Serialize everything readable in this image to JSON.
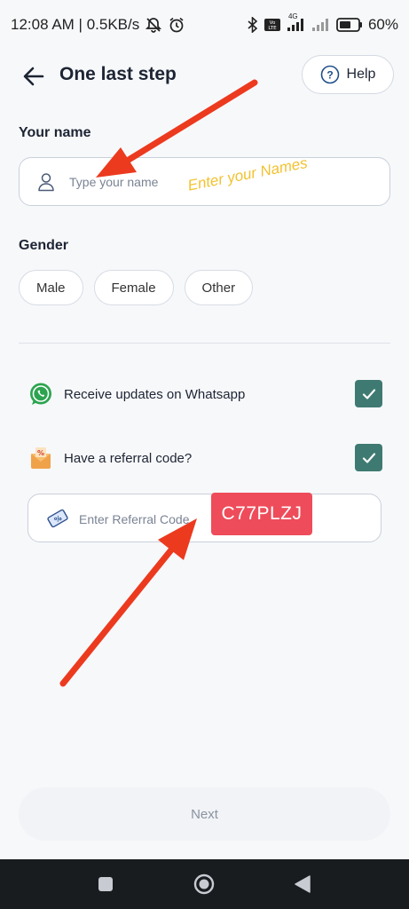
{
  "status_bar": {
    "time_speed": "12:08 AM | 0.5KB/s",
    "network_label": "4G",
    "battery": "60%"
  },
  "header": {
    "title": "One last step",
    "help_label": "Help"
  },
  "name_section": {
    "label": "Your name",
    "placeholder": "Type your name",
    "value": "",
    "annotation": "Enter your Names"
  },
  "gender_section": {
    "label": "Gender",
    "options": [
      "Male",
      "Female",
      "Other"
    ]
  },
  "options": {
    "whatsapp_label": "Receive updates on Whatsapp",
    "whatsapp_checked": true,
    "referral_label": "Have a referral code?",
    "referral_checked": true
  },
  "referral": {
    "placeholder": "Enter Referral Code",
    "value": "",
    "code_overlay": "C77PLZJ"
  },
  "next_label": "Next",
  "colors": {
    "accent": "#3e7a72",
    "annotation_arrow": "#ec3a1f",
    "code_badge": "#ee4c5a",
    "annotation_text": "#f2c230"
  }
}
